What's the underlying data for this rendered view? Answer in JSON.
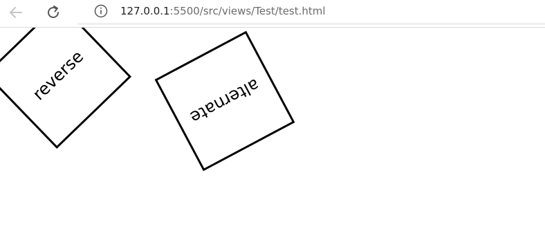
{
  "browser": {
    "url_host": "127.0.0.1",
    "url_rest": ":5500/src/views/Test/test.html"
  },
  "boxes": {
    "reverse_label": "reverse",
    "alternate_label": "alternate"
  },
  "icons": {
    "back": "back-arrow-icon",
    "reload": "reload-icon",
    "info": "info-icon"
  },
  "colors": {
    "box_border": "#000000",
    "toolbar_icon": "#555555",
    "back_disabled": "#c4c4c4"
  }
}
